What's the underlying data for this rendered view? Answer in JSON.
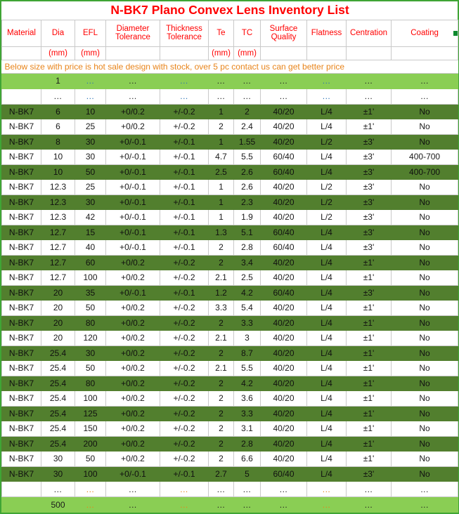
{
  "title": "N-BK7 Plano Convex Lens Inventory List",
  "notice": "Below size with price is hot sale design with stock, over 5 pc contact us can get better price",
  "columns": [
    {
      "label": "Material",
      "unit": ""
    },
    {
      "label": "Dia",
      "unit": "(mm)"
    },
    {
      "label": "EFL",
      "unit": "(mm)"
    },
    {
      "label": "Diameter Tolerance",
      "unit": ""
    },
    {
      "label": "Thickness Tolerance",
      "unit": ""
    },
    {
      "label": "Te",
      "unit": "(mm)"
    },
    {
      "label": "TC",
      "unit": "(mm)"
    },
    {
      "label": "Surface Quality",
      "unit": ""
    },
    {
      "label": "Flatness",
      "unit": ""
    },
    {
      "label": "Centration",
      "unit": ""
    },
    {
      "label": "Coating",
      "unit": ""
    }
  ],
  "header_lines": {
    "c0": "Material",
    "c1": "Dia",
    "c2": "EFL",
    "c3a": "Diameter",
    "c3b": "Tolerance",
    "c4a": "Thickness",
    "c4b": "Tolerance",
    "c5": "Te",
    "c6": "TC",
    "c7a": "Surface",
    "c7b": "Quality",
    "c8": "Flatness",
    "c9": "Centration",
    "c10": "Coating"
  },
  "units": {
    "c0": "",
    "c1": "(mm)",
    "c2": "(mm)",
    "c3": "",
    "c4": "",
    "c5": "(mm)",
    "c6": "(mm)",
    "c7": "",
    "c8": "",
    "c9": "",
    "c10": ""
  },
  "ellipsis": "...",
  "range_rows": {
    "min_label": "1",
    "max_label": "500"
  },
  "colors": {
    "title_red": "#ff0000",
    "header_red": "#ff0000",
    "notice_orange": "#e8841a",
    "row_dark_green": "#527f2e",
    "row_light_green": "#8ace54",
    "sheet_border_green": "#3fa535",
    "comment_marker_green": "#0c8a2e",
    "grid_line": "#c9c9c9"
  },
  "rows": [
    {
      "material": "N-BK7",
      "dia": "6",
      "efl": "10",
      "dia_tol": "+0/0.2",
      "thk_tol": "+/-0.2",
      "te": "1",
      "tc": "2",
      "sq": "40/20",
      "flat": "L/4",
      "cent": "±1'",
      "coating": "No"
    },
    {
      "material": "N-BK7",
      "dia": "6",
      "efl": "25",
      "dia_tol": "+0/0.2",
      "thk_tol": "+/-0.2",
      "te": "2",
      "tc": "2.4",
      "sq": "40/20",
      "flat": "L/4",
      "cent": "±1'",
      "coating": "No"
    },
    {
      "material": "N-BK7",
      "dia": "8",
      "efl": "30",
      "dia_tol": "+0/-0.1",
      "thk_tol": "+/-0.1",
      "te": "1",
      "tc": "1.55",
      "sq": "40/20",
      "flat": "L/2",
      "cent": "±3'",
      "coating": "No"
    },
    {
      "material": "N-BK7",
      "dia": "10",
      "efl": "30",
      "dia_tol": "+0/-0.1",
      "thk_tol": "+/-0.1",
      "te": "4.7",
      "tc": "5.5",
      "sq": "60/40",
      "flat": "L/4",
      "cent": "±3'",
      "coating": "400-700"
    },
    {
      "material": "N-BK7",
      "dia": "10",
      "efl": "50",
      "dia_tol": "+0/-0.1",
      "thk_tol": "+/-0.1",
      "te": "2.5",
      "tc": "2.6",
      "sq": "60/40",
      "flat": "L/4",
      "cent": "±3'",
      "coating": "400-700"
    },
    {
      "material": "N-BK7",
      "dia": "12.3",
      "efl": "25",
      "dia_tol": "+0/-0.1",
      "thk_tol": "+/-0.1",
      "te": "1",
      "tc": "2.6",
      "sq": "40/20",
      "flat": "L/2",
      "cent": "±3'",
      "coating": "No"
    },
    {
      "material": "N-BK7",
      "dia": "12.3",
      "efl": "30",
      "dia_tol": "+0/-0.1",
      "thk_tol": "+/-0.1",
      "te": "1",
      "tc": "2.3",
      "sq": "40/20",
      "flat": "L/2",
      "cent": "±3'",
      "coating": "No"
    },
    {
      "material": "N-BK7",
      "dia": "12.3",
      "efl": "42",
      "dia_tol": "+0/-0.1",
      "thk_tol": "+/-0.1",
      "te": "1",
      "tc": "1.9",
      "sq": "40/20",
      "flat": "L/2",
      "cent": "±3'",
      "coating": "No"
    },
    {
      "material": "N-BK7",
      "dia": "12.7",
      "efl": "15",
      "dia_tol": "+0/-0.1",
      "thk_tol": "+/-0.1",
      "te": "1.3",
      "tc": "5.1",
      "sq": "60/40",
      "flat": "L/4",
      "cent": "±3'",
      "coating": "No"
    },
    {
      "material": "N-BK7",
      "dia": "12.7",
      "efl": "40",
      "dia_tol": "+0/-0.1",
      "thk_tol": "+/-0.1",
      "te": "2",
      "tc": "2.8",
      "sq": "60/40",
      "flat": "L/4",
      "cent": "±3'",
      "coating": "No"
    },
    {
      "material": "N-BK7",
      "dia": "12.7",
      "efl": "60",
      "dia_tol": "+0/0.2",
      "thk_tol": "+/-0.2",
      "te": "2",
      "tc": "3.4",
      "sq": "40/20",
      "flat": "L/4",
      "cent": "±1'",
      "coating": "No"
    },
    {
      "material": "N-BK7",
      "dia": "12.7",
      "efl": "100",
      "dia_tol": "+0/0.2",
      "thk_tol": "+/-0.2",
      "te": "2.1",
      "tc": "2.5",
      "sq": "40/20",
      "flat": "L/4",
      "cent": "±1'",
      "coating": "No"
    },
    {
      "material": "N-BK7",
      "dia": "20",
      "efl": "35",
      "dia_tol": "+0/-0.1",
      "thk_tol": "+/-0.1",
      "te": "1.2",
      "tc": "4.2",
      "sq": "60/40",
      "flat": "L/4",
      "cent": "±3'",
      "coating": "No"
    },
    {
      "material": "N-BK7",
      "dia": "20",
      "efl": "50",
      "dia_tol": "+0/0.2",
      "thk_tol": "+/-0.2",
      "te": "3.3",
      "tc": "5.4",
      "sq": "40/20",
      "flat": "L/4",
      "cent": "±1'",
      "coating": "No"
    },
    {
      "material": "N-BK7",
      "dia": "20",
      "efl": "80",
      "dia_tol": "+0/0.2",
      "thk_tol": "+/-0.2",
      "te": "2",
      "tc": "3.3",
      "sq": "40/20",
      "flat": "L/4",
      "cent": "±1'",
      "coating": "No"
    },
    {
      "material": "N-BK7",
      "dia": "20",
      "efl": "120",
      "dia_tol": "+0/0.2",
      "thk_tol": "+/-0.2",
      "te": "2.1",
      "tc": "3",
      "sq": "40/20",
      "flat": "L/4",
      "cent": "±1'",
      "coating": "No"
    },
    {
      "material": "N-BK7",
      "dia": "25.4",
      "efl": "30",
      "dia_tol": "+0/0.2",
      "thk_tol": "+/-0.2",
      "te": "2",
      "tc": "8.7",
      "sq": "40/20",
      "flat": "L/4",
      "cent": "±1'",
      "coating": "No"
    },
    {
      "material": "N-BK7",
      "dia": "25.4",
      "efl": "50",
      "dia_tol": "+0/0.2",
      "thk_tol": "+/-0.2",
      "te": "2.1",
      "tc": "5.5",
      "sq": "40/20",
      "flat": "L/4",
      "cent": "±1'",
      "coating": "No"
    },
    {
      "material": "N-BK7",
      "dia": "25.4",
      "efl": "80",
      "dia_tol": "+0/0.2",
      "thk_tol": "+/-0.2",
      "te": "2",
      "tc": "4.2",
      "sq": "40/20",
      "flat": "L/4",
      "cent": "±1'",
      "coating": "No"
    },
    {
      "material": "N-BK7",
      "dia": "25.4",
      "efl": "100",
      "dia_tol": "+0/0.2",
      "thk_tol": "+/-0.2",
      "te": "2",
      "tc": "3.6",
      "sq": "40/20",
      "flat": "L/4",
      "cent": "±1'",
      "coating": "No"
    },
    {
      "material": "N-BK7",
      "dia": "25.4",
      "efl": "125",
      "dia_tol": "+0/0.2",
      "thk_tol": "+/-0.2",
      "te": "2",
      "tc": "3.3",
      "sq": "40/20",
      "flat": "L/4",
      "cent": "±1'",
      "coating": "No"
    },
    {
      "material": "N-BK7",
      "dia": "25.4",
      "efl": "150",
      "dia_tol": "+0/0.2",
      "thk_tol": "+/-0.2",
      "te": "2",
      "tc": "3.1",
      "sq": "40/20",
      "flat": "L/4",
      "cent": "±1'",
      "coating": "No"
    },
    {
      "material": "N-BK7",
      "dia": "25.4",
      "efl": "200",
      "dia_tol": "+0/0.2",
      "thk_tol": "+/-0.2",
      "te": "2",
      "tc": "2.8",
      "sq": "40/20",
      "flat": "L/4",
      "cent": "±1'",
      "coating": "No"
    },
    {
      "material": "N-BK7",
      "dia": "30",
      "efl": "50",
      "dia_tol": "+0/0.2",
      "thk_tol": "+/-0.2",
      "te": "2",
      "tc": "6.6",
      "sq": "40/20",
      "flat": "L/4",
      "cent": "±1'",
      "coating": "No"
    },
    {
      "material": "N-BK7",
      "dia": "30",
      "efl": "100",
      "dia_tol": "+0/-0.1",
      "thk_tol": "+/-0.1",
      "te": "2.7",
      "tc": "5",
      "sq": "60/40",
      "flat": "L/4",
      "cent": "±3'",
      "coating": "No"
    }
  ]
}
